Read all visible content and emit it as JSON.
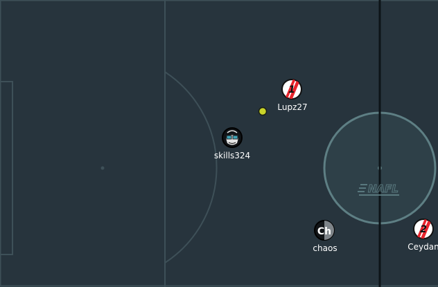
{
  "colors": {
    "pitch": "#27343d",
    "pitch_line": "#3e5058",
    "halfway_line": "#0d1418",
    "center_circle_fill": "#2e4048",
    "center_circle_stroke": "#5e7f84",
    "ball": "#c9d42a",
    "red_team": "#e8242c",
    "dark_team": "#111417",
    "label": "#ffffff"
  },
  "logo": {
    "text": "NAFL"
  },
  "players": [
    {
      "name": "Lupz27",
      "avatar": "1",
      "team": "red"
    },
    {
      "name": "skills324",
      "avatar": "face-icon",
      "team": "dark"
    },
    {
      "name": "chaos",
      "avatar": "Ch",
      "team": "dark"
    },
    {
      "name": "Ceydan",
      "avatar": "2",
      "team": "red"
    }
  ]
}
